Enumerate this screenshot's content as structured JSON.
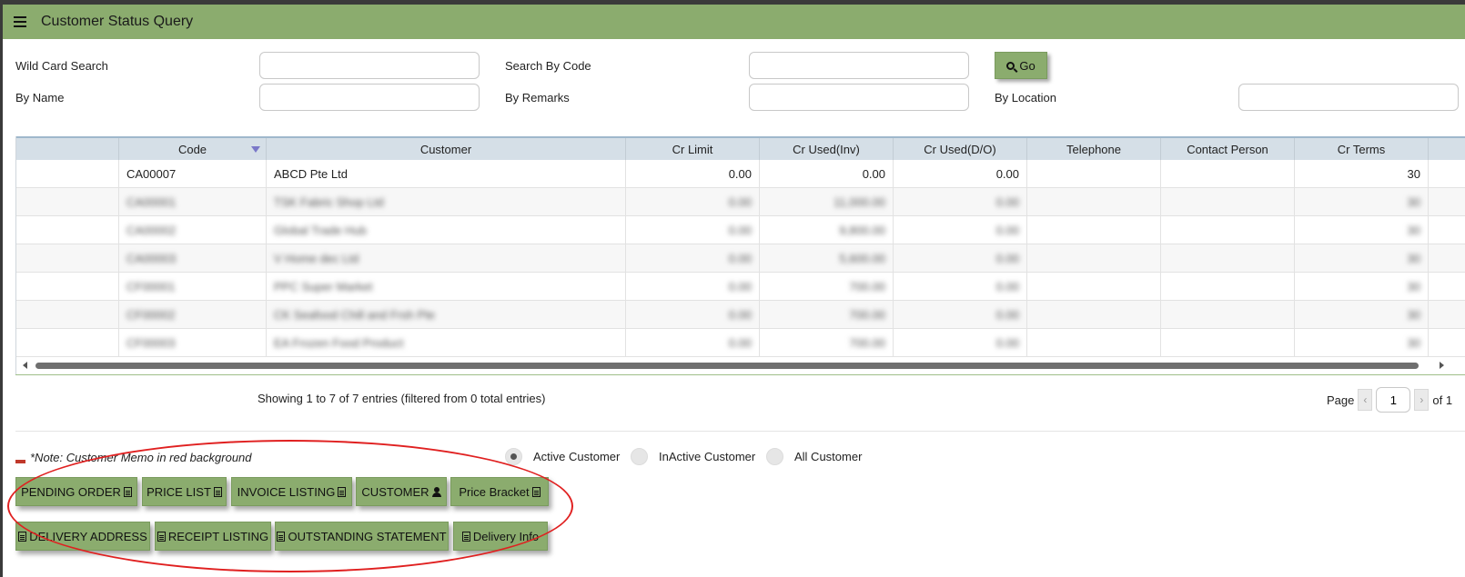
{
  "app": {
    "title": "Customer Status Query"
  },
  "search": {
    "wild_card_label": "Wild Card Search",
    "wild_card_value": "",
    "by_code_label": "Search By Code",
    "by_code_value": "",
    "by_name_label": "By Name",
    "by_name_value": "",
    "by_remarks_label": "By Remarks",
    "by_remarks_value": "",
    "by_location_label": "By Location",
    "by_location_value": "",
    "go_label": "Go"
  },
  "table": {
    "columns": [
      "",
      "Code",
      "Customer",
      "Cr Limit",
      "Cr Used(Inv)",
      "Cr Used(D/O)",
      "Telephone",
      "Contact Person",
      "Cr Terms"
    ],
    "sorted_column": "Code",
    "rows": [
      [
        "",
        "CA00007",
        "ABCD Pte Ltd",
        "0.00",
        "0.00",
        "0.00",
        "",
        "",
        "30"
      ],
      [
        "",
        "CA00001",
        "TSK Fabric Shop Ltd",
        "0.00",
        "11,000.00",
        "0.00",
        "",
        "",
        "30"
      ],
      [
        "",
        "CA00002",
        "Global Trade Hub",
        "0.00",
        "9,800.00",
        "0.00",
        "",
        "",
        "30"
      ],
      [
        "",
        "CA00003",
        "V Home dec Ltd",
        "0.00",
        "5,600.00",
        "0.00",
        "",
        "",
        "30"
      ],
      [
        "",
        "CF00001",
        "PPC Super Market",
        "0.00",
        "700.00",
        "0.00",
        "",
        "",
        "30"
      ],
      [
        "",
        "CF00002",
        "CK Seafood Chill and Frsh Pte",
        "0.00",
        "700.00",
        "0.00",
        "",
        "",
        "30"
      ],
      [
        "",
        "CF00003",
        "EA Frozen Food Product",
        "0.00",
        "700.00",
        "0.00",
        "",
        "",
        "30"
      ]
    ]
  },
  "footer": {
    "showing": "Showing 1 to 7 of 7 entries (filtered from 0 total entries)",
    "page_label": "Page",
    "page_value": "1",
    "of_label": "of 1",
    "prev": "‹",
    "next": "›"
  },
  "options": {
    "note": "*Note: Customer Memo in red background",
    "radios": [
      {
        "label": "Active Customer",
        "selected": true
      },
      {
        "label": "InActive Customer",
        "selected": false
      },
      {
        "label": "All Customer",
        "selected": false
      }
    ]
  },
  "actions": {
    "pending_order": "PENDING ORDER",
    "price_list": "PRICE LIST",
    "invoice_listing": "INVOICE LISTING",
    "customer": "CUSTOMER",
    "price_bracket": "Price Bracket",
    "delivery_address": "DELIVERY ADDRESS",
    "receipt_listing": "RECEIPT LISTING",
    "outstanding_statement": "OUTSTANDING STATEMENT",
    "delivery_info": "Delivery Info"
  },
  "colors": {
    "accent": "#8bac6e",
    "header_bg": "#d5dfe7",
    "annotation": "#e02020",
    "memo": "#c0392b"
  },
  "icons": [
    "hamburger-icon",
    "search-icon",
    "document-icon",
    "person-icon",
    "chevron-left-icon",
    "chevron-right-icon"
  ]
}
